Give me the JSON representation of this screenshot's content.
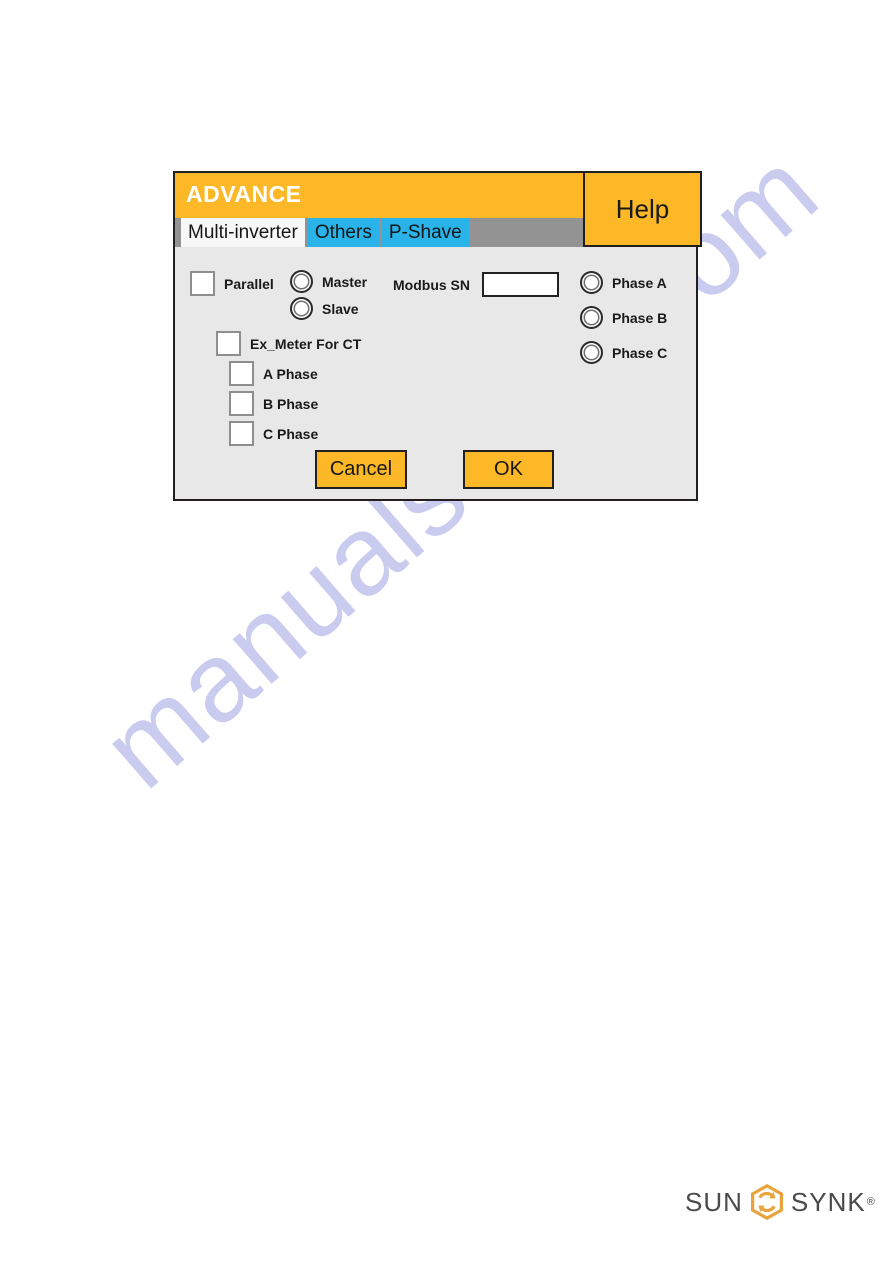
{
  "watermark": {
    "text": "manualshive.com"
  },
  "dialog": {
    "title": "ADVANCE",
    "help_label": "Help",
    "tabs": [
      {
        "label": "Multi-inverter",
        "active": true
      },
      {
        "label": "Others",
        "active": false
      },
      {
        "label": "P-Shave",
        "active": false
      }
    ],
    "checkboxes": [
      {
        "label": "Parallel",
        "checked": false
      },
      {
        "label": "Ex_Meter For CT",
        "checked": false
      },
      {
        "label": "A Phase",
        "checked": false
      },
      {
        "label": "B Phase",
        "checked": false
      },
      {
        "label": "C Phase",
        "checked": false
      }
    ],
    "mode_radios": [
      {
        "label": "Master",
        "selected": false
      },
      {
        "label": "Slave",
        "selected": false
      }
    ],
    "phase_radios": [
      {
        "label": "Phase A",
        "selected": false
      },
      {
        "label": "Phase B",
        "selected": false
      },
      {
        "label": "Phase C",
        "selected": false
      }
    ],
    "modbus": {
      "label": "Modbus SN",
      "value": "",
      "placeholder": ""
    },
    "buttons": {
      "cancel": "Cancel",
      "ok": "OK"
    },
    "colors": {
      "accent_orange": "#fcb827",
      "tab_blue": "#29b3e8",
      "tab_gray": "#939393",
      "body_gray": "#e8e8e8",
      "border_dark": "#231f20"
    }
  },
  "logo": {
    "word_left": "SUN",
    "word_right": "SYNK",
    "registered_mark": "®",
    "icon": "sunsynk-hex-arrows-icon",
    "color": "#e8a33d"
  }
}
